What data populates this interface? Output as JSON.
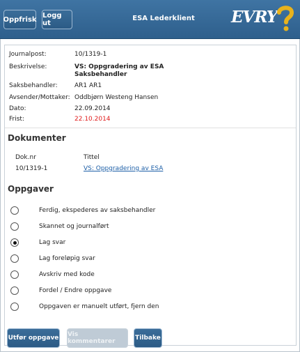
{
  "header": {
    "refresh_label": "Oppfrisk",
    "logout_label": "Logg ut",
    "title": "ESA Lederklient",
    "logo_text": "EVRY",
    "help_icon": "question-mark-icon"
  },
  "details": {
    "journalpost": {
      "label": "Journalpost:",
      "value": "10/1319-1"
    },
    "beskrivelse": {
      "label": "Beskrivelse:",
      "value_line1": "VS: Oppgradering av ESA",
      "value_line2": "Saksbehandler"
    },
    "saksbehandler": {
      "label": "Saksbehandler:",
      "value": "AR1 AR1"
    },
    "avsender": {
      "label": "Avsender/Mottaker:",
      "value": "Oddbjørn Westeng Hansen"
    },
    "dato": {
      "label": "Dato:",
      "value": "22.09.2014"
    },
    "frist": {
      "label": "Frist:",
      "value": "22.10.2014",
      "color": "#e01b1b"
    }
  },
  "documents": {
    "heading": "Dokumenter",
    "columns": [
      "Dok.nr",
      "Tittel"
    ],
    "rows": [
      {
        "dok_nr": "10/1319-1",
        "tittel": "VS: Oppgradering av ESA"
      }
    ]
  },
  "tasks": {
    "heading": "Oppgaver",
    "options": [
      {
        "label": "Ferdig, ekspederes av saksbehandler",
        "selected": false
      },
      {
        "label": "Skannet og journalført",
        "selected": false
      },
      {
        "label": "Lag svar",
        "selected": true
      },
      {
        "label": "Lag foreløpig svar",
        "selected": false
      },
      {
        "label": "Avskriv med kode",
        "selected": false
      },
      {
        "label": "Fordel / Endre oppgave",
        "selected": false
      },
      {
        "label": "Oppgaven er manuelt utført, fjern den",
        "selected": false
      }
    ]
  },
  "footer": {
    "perform_label": "Utfør oppgave",
    "comments_label": "Vis kommentarer",
    "back_label": "Tilbake"
  },
  "colors": {
    "header": "#356893",
    "accent_red": "#e01b1b",
    "link": "#1d5fa7"
  }
}
